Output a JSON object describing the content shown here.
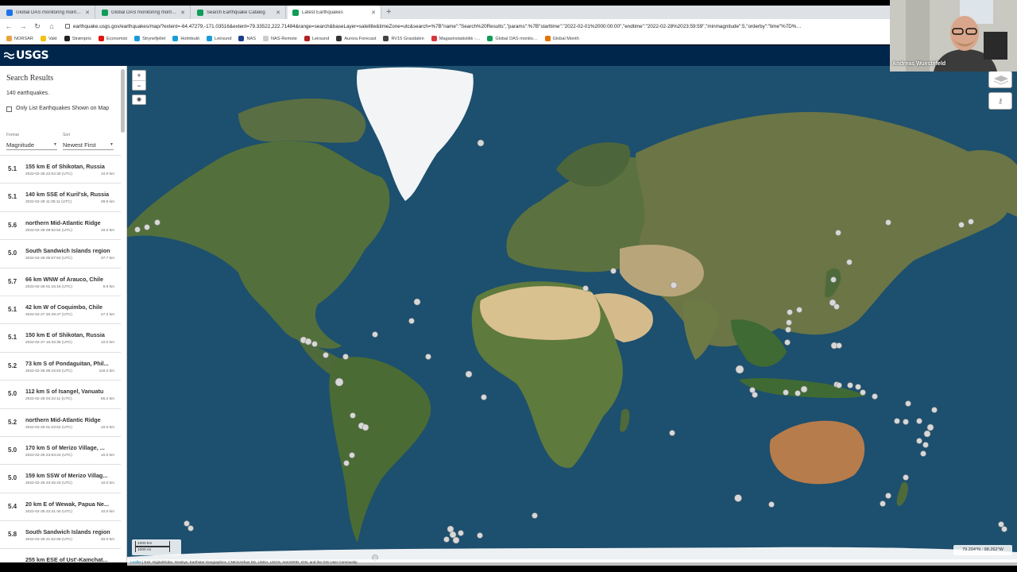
{
  "browser": {
    "tabs": [
      {
        "title": "Global DAS monitoring month f…",
        "fav": "#1a73e8"
      },
      {
        "title": "Global DAS monitoring month - S…",
        "fav": "#0f9d58"
      },
      {
        "title": "Search Earthquake Catalog",
        "fav": "#0f9d58"
      },
      {
        "title": "Latest Earthquakes",
        "fav": "#0f9d58"
      }
    ],
    "new_tab": "+",
    "url": "earthquake.usgs.gov/earthquakes/map/?extent=-64.47279,-171.03516&extent=79.33522,222.71484&range=search&baseLayer=satellite&timeZone=utc&search=%7B\"name\":\"Search%20Results\",\"params\":%7B\"starttime\":\"2022-02-01%2000:00:00\",\"endtime\":\"2022-02-28%2023:59:59\",\"minmagnitude\":5,\"orderby\":\"time\"%7D%…",
    "bookmarks": [
      {
        "label": "NORSAR",
        "color": "#e8a33d"
      },
      {
        "label": "Vakt",
        "color": "#f4c20d"
      },
      {
        "label": "Strømpris",
        "color": "#222222"
      },
      {
        "label": "Economist",
        "color": "#e3120b"
      },
      {
        "label": "Strynefjellet",
        "color": "#1a9bd7"
      },
      {
        "label": "Holmbukt",
        "color": "#1a9bd7"
      },
      {
        "label": "Leirsund",
        "color": "#1a9bd7"
      },
      {
        "label": "NAS",
        "color": "#1b3e8f"
      },
      {
        "label": "NAS-Remote",
        "color": "#cccccc"
      },
      {
        "label": "Leirsund",
        "color": "#b22222"
      },
      {
        "label": "Aurora Forecast",
        "color": "#333333"
      },
      {
        "label": "RV15 Grasdalen",
        "color": "#444444"
      },
      {
        "label": "Magasinstatistikk -…",
        "color": "#d9363e"
      },
      {
        "label": "Global DAS monito…",
        "color": "#0f9d58"
      },
      {
        "label": "Global Month",
        "color": "#e37400"
      }
    ]
  },
  "header": {
    "logo": "USGS"
  },
  "sidebar": {
    "title": "Search Results",
    "count": "140 earthquakes.",
    "checkbox_label": "Only List Earthquakes Shown on Map",
    "format_label": "Format",
    "format_value": "Magnitude",
    "sort_label": "Sort",
    "sort_value": "Newest First"
  },
  "earthquakes": [
    {
      "mag": "5.1",
      "place": "155 km E of Shikotan, Russia",
      "time": "2022-02-28 22:04:30 (UTC)",
      "depth": "10.0 km"
    },
    {
      "mag": "5.1",
      "place": "140 km SSE of Kuril'sk, Russia",
      "time": "2022-02-28 11:35:11 (UTC)",
      "depth": "39.6 km"
    },
    {
      "mag": "5.6",
      "place": "northern Mid-Atlantic Ridge",
      "time": "2022-02-28 09:52:54 (UTC)",
      "depth": "10.0 km"
    },
    {
      "mag": "5.0",
      "place": "South Sandwich Islands region",
      "time": "2022-02-28 05:57:53 (UTC)",
      "depth": "37.7 km"
    },
    {
      "mag": "5.7",
      "place": "66 km WNW of Arauco, Chile",
      "time": "2022-02-28 01:15:16 (UTC)",
      "depth": "9.9 km"
    },
    {
      "mag": "5.1",
      "place": "42 km W of Coquimbo, Chile",
      "time": "2022-02-27 20:49:47 (UTC)",
      "depth": "27.2 km"
    },
    {
      "mag": "5.1",
      "place": "150 km E of Shikotan, Russia",
      "time": "2022-02-27 16:33:35 (UTC)",
      "depth": "10.0 km"
    },
    {
      "mag": "5.2",
      "place": "73 km S of Pondaguitan, Phil...",
      "time": "2022-02-26 06:15:53 (UTC)",
      "depth": "119.2 km"
    },
    {
      "mag": "5.0",
      "place": "112 km S of Isangel, Vanuatu",
      "time": "2022-02-26 04:22:11 (UTC)",
      "depth": "65.2 km"
    },
    {
      "mag": "5.2",
      "place": "northern Mid-Atlantic Ridge",
      "time": "2022-02-26 01:23:52 (UTC)",
      "depth": "10.0 km"
    },
    {
      "mag": "5.0",
      "place": "170 km S of Merizo Village, ...",
      "time": "2022-02-25 23:53:24 (UTC)",
      "depth": "10.0 km"
    },
    {
      "mag": "5.0",
      "place": "159 km SSW of Merizo Villag...",
      "time": "2022-02-25 23:45:43 (UTC)",
      "depth": "10.0 km"
    },
    {
      "mag": "5.4",
      "place": "20 km E of Wewak, Papua Ne...",
      "time": "2022-02-25 23:41:40 (UTC)",
      "depth": "10.0 km"
    },
    {
      "mag": "5.8",
      "place": "South Sandwich Islands region",
      "time": "2022-02-25 21:52:08 (UTC)",
      "depth": "40.0 km"
    },
    {
      "mag": "",
      "place": "255 km ESE of Ust'-Kamchat...",
      "time": "",
      "depth": ""
    }
  ],
  "map": {
    "zoom_in": "+",
    "zoom_out": "−",
    "scale_km": "1000 km",
    "scale_mi": "1000 mi",
    "coords": "79.204°N : 98.262°W",
    "attribution_leaflet": "Leaflet",
    "attribution": " | Esri, DigitalGlobe, GeoEye, Earthstar Geographics, CNES/Airbus DS, USDA, USGS, AeroGRID, IGN, and the GIS User Community",
    "ocean_color": "#1d4f6e",
    "land_color": "#4f6a3a",
    "desert_color": "#c9b184",
    "ice_color": "#f2f4f5",
    "quake_color": "#d8d8d8"
  },
  "webcam": {
    "name": "Andreas Wuestefeld"
  }
}
